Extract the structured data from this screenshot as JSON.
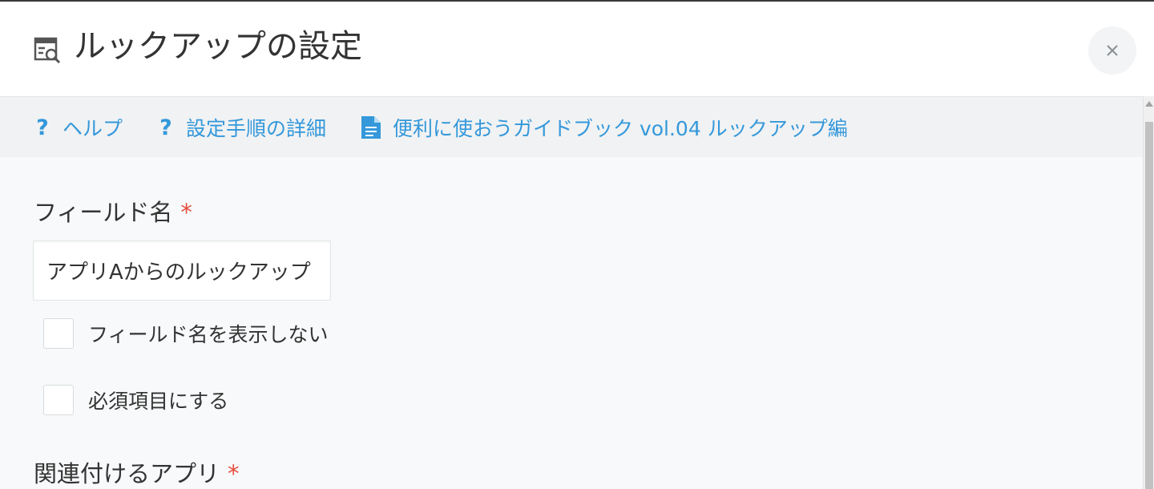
{
  "dialog": {
    "title": "ルックアップの設定",
    "title_icon": "lookup-settings-icon",
    "close_label": "×"
  },
  "links": [
    {
      "icon": "help-icon",
      "glyph": "?",
      "label": "ヘルプ"
    },
    {
      "icon": "help-icon",
      "glyph": "?",
      "label": "設定手順の詳細"
    },
    {
      "icon": "document-icon",
      "label": "便利に使おうガイドブック vol.04 ルックアップ編"
    }
  ],
  "form": {
    "field_name": {
      "label": "フィールド名",
      "required_mark": "*",
      "value": "アプリAからのルックアップ"
    },
    "hide_field_name": {
      "label": "フィールド名を表示しない",
      "checked": false
    },
    "required_field": {
      "label": "必須項目にする",
      "checked": false
    },
    "related_app": {
      "label": "関連付けるアプリ",
      "required_mark": "*"
    }
  },
  "colors": {
    "link": "#3498db",
    "required": "#e74c3c",
    "header_bg": "#ffffff",
    "linkbar_bg": "#f1f2f3",
    "content_bg": "#f7f9fa"
  }
}
